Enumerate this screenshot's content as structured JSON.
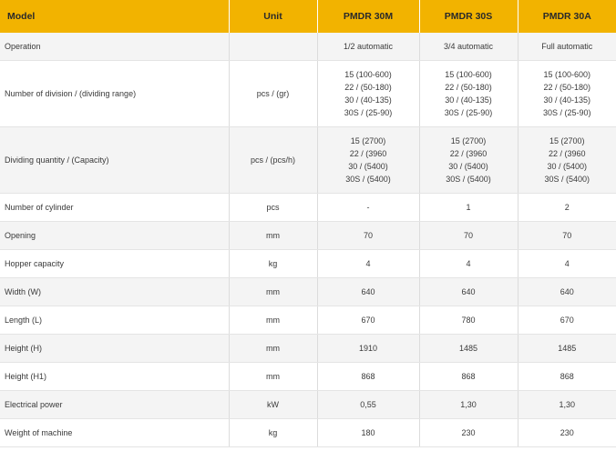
{
  "header": {
    "model": "Model",
    "unit": "Unit",
    "m1": "PMDR 30M",
    "m2": "PMDR 30S",
    "m3": "PMDR 30A"
  },
  "rows": {
    "operation": {
      "label": "Operation",
      "unit": "",
      "m1": "1/2 automatic",
      "m2": "3/4 automatic",
      "m3": "Full automatic"
    },
    "division": {
      "label": "Number of division / (dividing range)",
      "unit": "pcs / (gr)",
      "m1": [
        "15 (100-600)",
        "22 / (50-180)",
        "30 / (40-135)",
        "30S / (25-90)"
      ],
      "m2": [
        "15 (100-600)",
        "22 / (50-180)",
        "30 / (40-135)",
        "30S / (25-90)"
      ],
      "m3": [
        "15 (100-600)",
        "22 / (50-180)",
        "30 / (40-135)",
        "30S / (25-90)"
      ]
    },
    "capacity": {
      "label": "Dividing quantity / (Capacity)",
      "unit": "pcs / (pcs/h)",
      "m1": [
        "15 (2700)",
        "22 / (3960",
        "30 / (5400)",
        "30S / (5400)"
      ],
      "m2": [
        "15 (2700)",
        "22 / (3960",
        "30 / (5400)",
        "30S / (5400)"
      ],
      "m3": [
        "15 (2700)",
        "22 / (3960",
        "30 / (5400)",
        "30S / (5400)"
      ]
    },
    "cylinder": {
      "label": "Number of cylinder",
      "unit": "pcs",
      "m1": "-",
      "m2": "1",
      "m3": "2"
    },
    "opening": {
      "label": "Opening",
      "unit": "mm",
      "m1": "70",
      "m2": "70",
      "m3": "70"
    },
    "hopper": {
      "label": "Hopper capacity",
      "unit": "kg",
      "m1": "4",
      "m2": "4",
      "m3": "4"
    },
    "width": {
      "label": "Width (W)",
      "unit": "mm",
      "m1": "640",
      "m2": "640",
      "m3": "640"
    },
    "length": {
      "label": "Length (L)",
      "unit": "mm",
      "m1": "670",
      "m2": "780",
      "m3": "670"
    },
    "height": {
      "label": "Height (H)",
      "unit": "mm",
      "m1": "1910",
      "m2": "1485",
      "m3": "1485"
    },
    "height1": {
      "label": "Height (H1)",
      "unit": "mm",
      "m1": "868",
      "m2": "868",
      "m3": "868"
    },
    "power": {
      "label": "Electrical power",
      "unit": "kW",
      "m1": "0,55",
      "m2": "1,30",
      "m3": "1,30"
    },
    "weight": {
      "label": "Weight of machine",
      "unit": "kg",
      "m1": "180",
      "m2": "230",
      "m3": "230"
    }
  },
  "colors": {
    "header_bg": "#f2b300",
    "row_stripe": "#f4f4f4",
    "text": "#3a3a3a"
  }
}
